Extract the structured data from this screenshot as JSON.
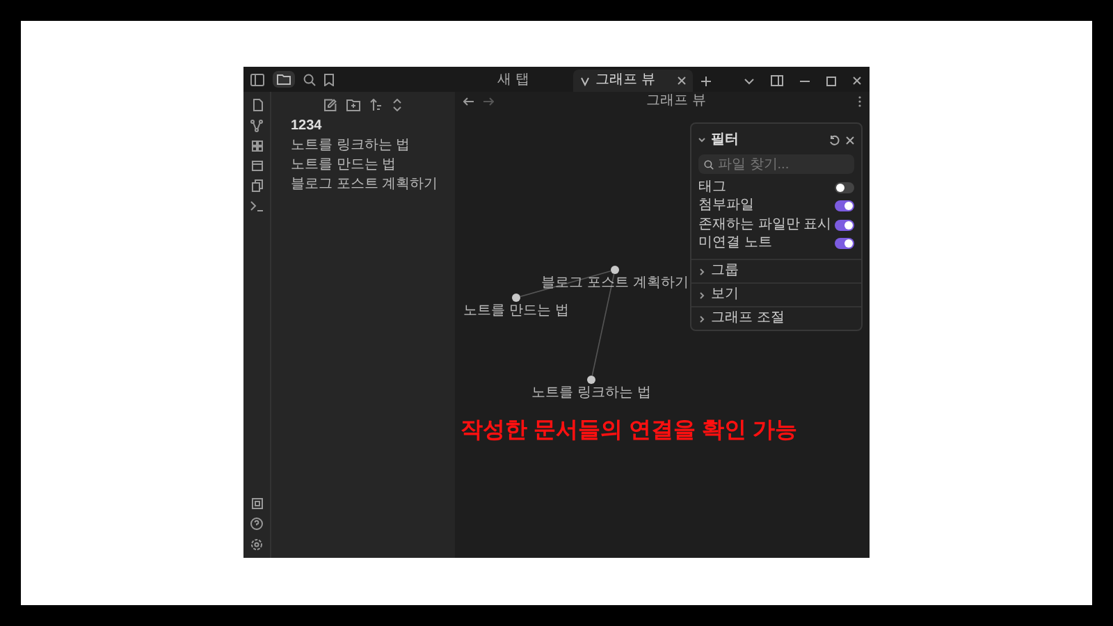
{
  "title_bar": {
    "tabs": [
      {
        "label": "새 탭",
        "selected": false
      },
      {
        "label": "그래프 뷰",
        "selected": true
      }
    ]
  },
  "file_explorer": {
    "items": [
      {
        "label": "1234",
        "kind": "folder"
      },
      {
        "label": "노트를 링크하는 법",
        "kind": "note"
      },
      {
        "label": "노트를 만드는 법",
        "kind": "note"
      },
      {
        "label": "블로그 포스트 계획하기",
        "kind": "note"
      }
    ]
  },
  "graph_view": {
    "title": "그래프 뷰",
    "nodes": [
      {
        "label": "블로그 포스트 계획하기"
      },
      {
        "label": "노트를 만드는 법"
      },
      {
        "label": "노트를 링크하는 법"
      }
    ]
  },
  "filter_panel": {
    "title": "필터",
    "expanded": true,
    "search": {
      "placeholder": "파일 찾기..."
    },
    "toggles": [
      {
        "label": "태그",
        "on": false
      },
      {
        "label": "첨부파일",
        "on": true
      },
      {
        "label": "존재하는 파일만 표시",
        "on": true
      },
      {
        "label": "미연결 노트",
        "on": true
      }
    ],
    "sections": [
      {
        "label": "그룹",
        "expanded": false
      },
      {
        "label": "보기",
        "expanded": false
      },
      {
        "label": "그래프 조절",
        "expanded": false
      }
    ]
  },
  "caption": "작성한 문서들의 연결을 확인 가능"
}
